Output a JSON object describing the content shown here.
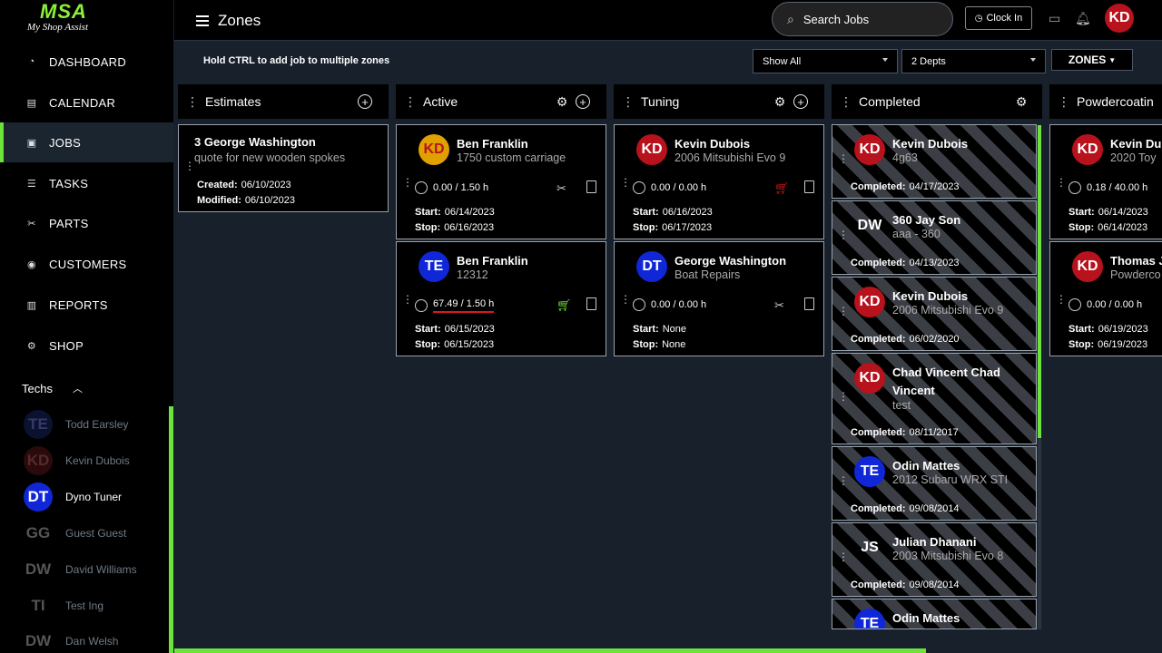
{
  "logo": {
    "big": "MSA",
    "small": "My Shop Assist"
  },
  "nav": [
    {
      "label": "DASHBOARD",
      "icon": "gauge-icon"
    },
    {
      "label": "CALENDAR",
      "icon": "calendar-icon"
    },
    {
      "label": "JOBS",
      "icon": "clipboard-icon"
    },
    {
      "label": "TASKS",
      "icon": "list-icon"
    },
    {
      "label": "PARTS",
      "icon": "wrench-icon"
    },
    {
      "label": "CUSTOMERS",
      "icon": "user-circle-icon"
    },
    {
      "label": "REPORTS",
      "icon": "chart-icon"
    },
    {
      "label": "SHOP",
      "icon": "gear-icon"
    }
  ],
  "techs": {
    "label": "Techs",
    "items": [
      {
        "initials": "TE",
        "name": "Todd Earsley"
      },
      {
        "initials": "KD",
        "name": "Kevin Dubois"
      },
      {
        "initials": "DT",
        "name": "Dyno Tuner"
      },
      {
        "initials": "GG",
        "name": "Guest Guest"
      },
      {
        "initials": "DW",
        "name": "David Williams"
      },
      {
        "initials": "TI",
        "name": "Test Ing"
      },
      {
        "initials": "DW",
        "name": "Dan Welsh"
      }
    ]
  },
  "header": {
    "title": "Zones",
    "search_placeholder": "Search Jobs",
    "clock_in": "Clock In",
    "user_initials": "KD"
  },
  "toolbar": {
    "hint": "Hold CTRL to add job to multiple zones",
    "filter1": "Show All",
    "filter2": "2 Depts",
    "zones_btn": "ZONES"
  },
  "columns": [
    {
      "title": "Estimates"
    },
    {
      "title": "Active"
    },
    {
      "title": "Tuning"
    },
    {
      "title": "Completed"
    },
    {
      "title": "Powdercoatin"
    }
  ],
  "estimates": [
    {
      "name": "3 George Washington",
      "sub": "quote for new wooden spokes",
      "created_label": "Created:",
      "created": "06/10/2023",
      "modified_label": "Modified:",
      "modified": "06/10/2023"
    }
  ],
  "active": [
    {
      "initials": "KD",
      "name": "Ben Franklin",
      "sub": "1750 custom carriage",
      "hours": "0.00 / 1.50 h",
      "start": "06/14/2023",
      "stop": "06/16/2023"
    },
    {
      "initials": "TE",
      "name": "Ben Franklin",
      "sub": "12312",
      "hours": "67.49 / 1.50 h",
      "start": "06/15/2023",
      "stop": "06/15/2023"
    }
  ],
  "tuning": [
    {
      "initials": "KD",
      "name": "Kevin Dubois",
      "sub": "2006 Mitsubishi Evo 9",
      "hours": "0.00 / 0.00 h",
      "start": "06/16/2023",
      "stop": "06/17/2023"
    },
    {
      "initials": "DT",
      "name": "George Washington",
      "sub": "Boat Repairs",
      "hours": "0.00 / 0.00 h",
      "start": "None",
      "stop": "None"
    }
  ],
  "completed": [
    {
      "initials": "KD",
      "name": "Kevin Dubois",
      "sub": "4g63",
      "completed": "04/17/2023"
    },
    {
      "initials": "DW",
      "name": "360 Jay Son",
      "sub": "aaa - 360",
      "completed": "04/13/2023"
    },
    {
      "initials": "KD",
      "name": "Kevin Dubois",
      "sub": "2006 Mitsubishi Evo 9",
      "completed": "06/02/2020"
    },
    {
      "initials": "KD",
      "name": "Chad Vincent Chad Vincent",
      "sub": "test",
      "completed": "08/11/2017"
    },
    {
      "initials": "TE",
      "name": "Odin Mattes",
      "sub": "2012 Subaru WRX STI",
      "completed": "09/08/2014"
    },
    {
      "initials": "JS",
      "name": "Julian Dhanani",
      "sub": "2003 Mitsubishi Evo 8",
      "completed": "09/08/2014"
    },
    {
      "initials": "TE",
      "name": "Odin Mattes",
      "sub": "",
      "completed": ""
    }
  ],
  "powder": [
    {
      "initials": "KD",
      "name": "Kevin Du",
      "sub": "2020 Toy",
      "hours": "0.18 / 40.00 h",
      "start": "06/14/2023",
      "stop": "06/14/2023"
    },
    {
      "initials": "KD",
      "name": "Thomas J",
      "sub": "Powderco",
      "hours": "0.00 / 0.00 h",
      "start": "06/19/2023",
      "stop": "06/19/2023"
    }
  ],
  "labels": {
    "start": "Start:",
    "stop": "Stop:",
    "completed": "Completed:"
  },
  "colors": {
    "accent": "#6ce33b",
    "kd_red": "#b8121c",
    "blue": "#1027d8"
  }
}
